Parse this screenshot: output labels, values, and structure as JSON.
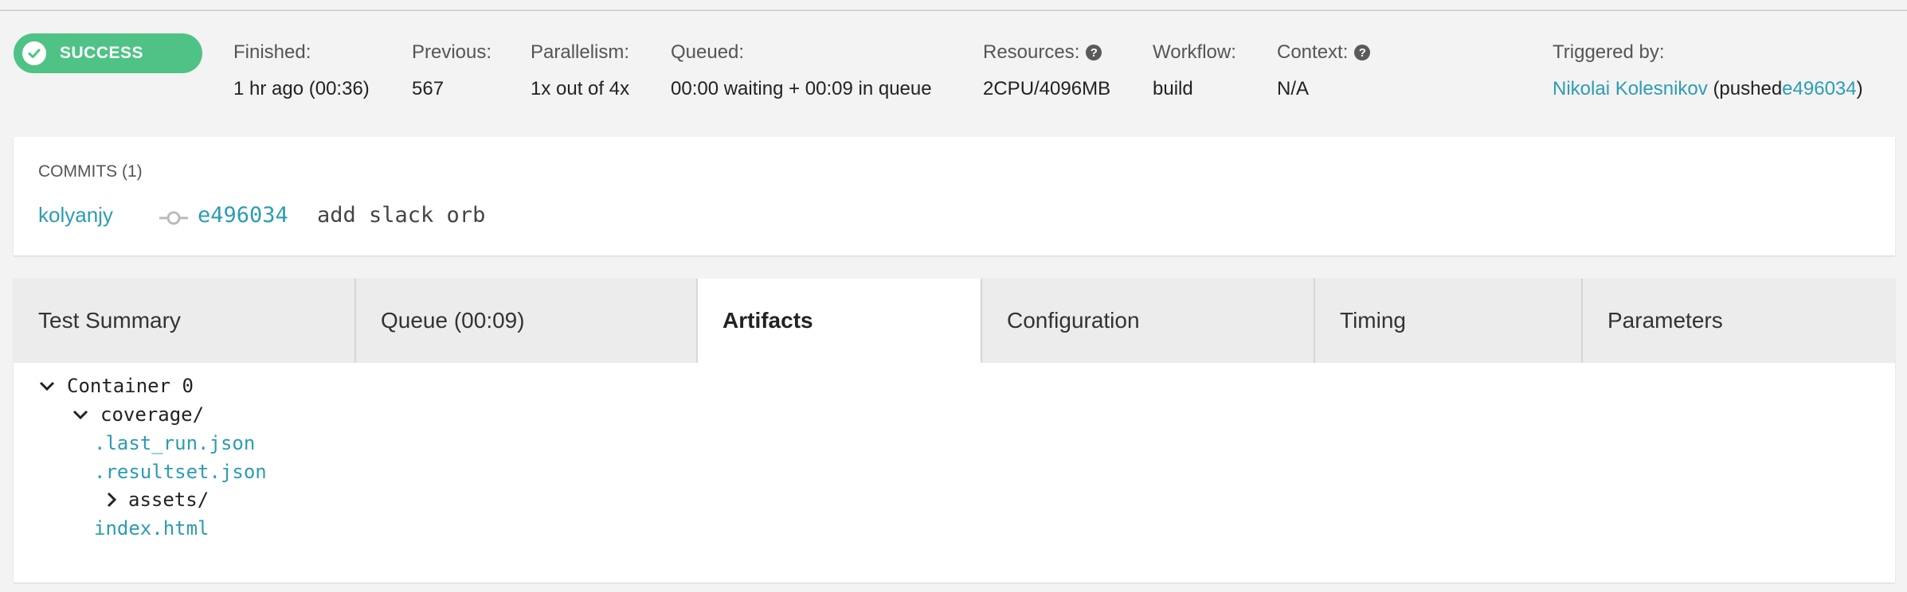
{
  "status": {
    "label": "SUCCESS",
    "color": "#4fc385"
  },
  "meta": {
    "finished_label": "Finished:",
    "finished_value": "1 hr ago (00:36)",
    "previous_label": "Previous:",
    "previous_value": "567",
    "parallelism_label": "Parallelism:",
    "parallelism_value": "1x out of 4x",
    "queued_label": "Queued:",
    "queued_value": "00:00 waiting + 00:09 in queue",
    "resources_label": "Resources:",
    "resources_value": "2CPU/4096MB",
    "workflow_label": "Workflow:",
    "workflow_value": "build",
    "context_label": "Context:",
    "context_value": "N/A",
    "triggered_label": "Triggered by:",
    "triggered_user": "Nikolai Kolesnikov",
    "triggered_pushed": "(pushed",
    "triggered_sha": "e496034",
    "triggered_close": ")",
    "help_glyph": "?"
  },
  "commits": {
    "title": "COMMITS (1)",
    "author": "kolyanjy",
    "sha": "e496034",
    "message": "add slack orb"
  },
  "tabs": [
    {
      "label": "Test Summary"
    },
    {
      "label": "Queue (00:09)"
    },
    {
      "label": "Artifacts"
    },
    {
      "label": "Configuration"
    },
    {
      "label": "Timing"
    },
    {
      "label": "Parameters"
    }
  ],
  "artifacts": {
    "container": "Container 0",
    "coverage_dir": "coverage/",
    "file1": ".last_run.json",
    "file2": ".resultset.json",
    "assets_dir": "assets/",
    "file3": "index.html"
  },
  "colors": {
    "link": "#2c9cb3",
    "success": "#4fc385"
  }
}
